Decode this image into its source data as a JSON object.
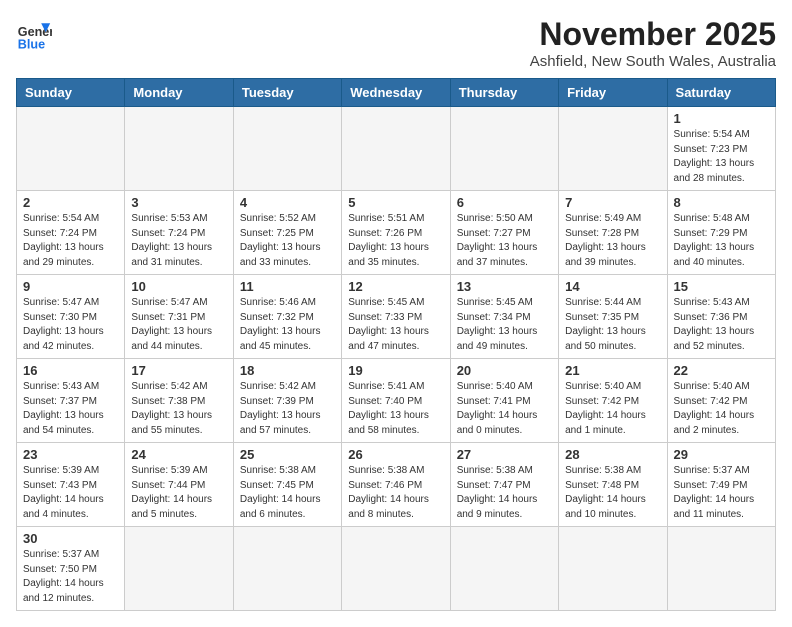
{
  "logo": {
    "line1": "General",
    "line2": "Blue"
  },
  "header": {
    "month": "November 2025",
    "location": "Ashfield, New South Wales, Australia"
  },
  "weekdays": [
    "Sunday",
    "Monday",
    "Tuesday",
    "Wednesday",
    "Thursday",
    "Friday",
    "Saturday"
  ],
  "weeks": [
    [
      {
        "day": "",
        "info": ""
      },
      {
        "day": "",
        "info": ""
      },
      {
        "day": "",
        "info": ""
      },
      {
        "day": "",
        "info": ""
      },
      {
        "day": "",
        "info": ""
      },
      {
        "day": "",
        "info": ""
      },
      {
        "day": "1",
        "info": "Sunrise: 5:54 AM\nSunset: 7:23 PM\nDaylight: 13 hours\nand 28 minutes."
      }
    ],
    [
      {
        "day": "2",
        "info": "Sunrise: 5:54 AM\nSunset: 7:24 PM\nDaylight: 13 hours\nand 29 minutes."
      },
      {
        "day": "3",
        "info": "Sunrise: 5:53 AM\nSunset: 7:24 PM\nDaylight: 13 hours\nand 31 minutes."
      },
      {
        "day": "4",
        "info": "Sunrise: 5:52 AM\nSunset: 7:25 PM\nDaylight: 13 hours\nand 33 minutes."
      },
      {
        "day": "5",
        "info": "Sunrise: 5:51 AM\nSunset: 7:26 PM\nDaylight: 13 hours\nand 35 minutes."
      },
      {
        "day": "6",
        "info": "Sunrise: 5:50 AM\nSunset: 7:27 PM\nDaylight: 13 hours\nand 37 minutes."
      },
      {
        "day": "7",
        "info": "Sunrise: 5:49 AM\nSunset: 7:28 PM\nDaylight: 13 hours\nand 39 minutes."
      },
      {
        "day": "8",
        "info": "Sunrise: 5:48 AM\nSunset: 7:29 PM\nDaylight: 13 hours\nand 40 minutes."
      }
    ],
    [
      {
        "day": "9",
        "info": "Sunrise: 5:47 AM\nSunset: 7:30 PM\nDaylight: 13 hours\nand 42 minutes."
      },
      {
        "day": "10",
        "info": "Sunrise: 5:47 AM\nSunset: 7:31 PM\nDaylight: 13 hours\nand 44 minutes."
      },
      {
        "day": "11",
        "info": "Sunrise: 5:46 AM\nSunset: 7:32 PM\nDaylight: 13 hours\nand 45 minutes."
      },
      {
        "day": "12",
        "info": "Sunrise: 5:45 AM\nSunset: 7:33 PM\nDaylight: 13 hours\nand 47 minutes."
      },
      {
        "day": "13",
        "info": "Sunrise: 5:45 AM\nSunset: 7:34 PM\nDaylight: 13 hours\nand 49 minutes."
      },
      {
        "day": "14",
        "info": "Sunrise: 5:44 AM\nSunset: 7:35 PM\nDaylight: 13 hours\nand 50 minutes."
      },
      {
        "day": "15",
        "info": "Sunrise: 5:43 AM\nSunset: 7:36 PM\nDaylight: 13 hours\nand 52 minutes."
      }
    ],
    [
      {
        "day": "16",
        "info": "Sunrise: 5:43 AM\nSunset: 7:37 PM\nDaylight: 13 hours\nand 54 minutes."
      },
      {
        "day": "17",
        "info": "Sunrise: 5:42 AM\nSunset: 7:38 PM\nDaylight: 13 hours\nand 55 minutes."
      },
      {
        "day": "18",
        "info": "Sunrise: 5:42 AM\nSunset: 7:39 PM\nDaylight: 13 hours\nand 57 minutes."
      },
      {
        "day": "19",
        "info": "Sunrise: 5:41 AM\nSunset: 7:40 PM\nDaylight: 13 hours\nand 58 minutes."
      },
      {
        "day": "20",
        "info": "Sunrise: 5:40 AM\nSunset: 7:41 PM\nDaylight: 14 hours\nand 0 minutes."
      },
      {
        "day": "21",
        "info": "Sunrise: 5:40 AM\nSunset: 7:42 PM\nDaylight: 14 hours\nand 1 minute."
      },
      {
        "day": "22",
        "info": "Sunrise: 5:40 AM\nSunset: 7:42 PM\nDaylight: 14 hours\nand 2 minutes."
      }
    ],
    [
      {
        "day": "23",
        "info": "Sunrise: 5:39 AM\nSunset: 7:43 PM\nDaylight: 14 hours\nand 4 minutes."
      },
      {
        "day": "24",
        "info": "Sunrise: 5:39 AM\nSunset: 7:44 PM\nDaylight: 14 hours\nand 5 minutes."
      },
      {
        "day": "25",
        "info": "Sunrise: 5:38 AM\nSunset: 7:45 PM\nDaylight: 14 hours\nand 6 minutes."
      },
      {
        "day": "26",
        "info": "Sunrise: 5:38 AM\nSunset: 7:46 PM\nDaylight: 14 hours\nand 8 minutes."
      },
      {
        "day": "27",
        "info": "Sunrise: 5:38 AM\nSunset: 7:47 PM\nDaylight: 14 hours\nand 9 minutes."
      },
      {
        "day": "28",
        "info": "Sunrise: 5:38 AM\nSunset: 7:48 PM\nDaylight: 14 hours\nand 10 minutes."
      },
      {
        "day": "29",
        "info": "Sunrise: 5:37 AM\nSunset: 7:49 PM\nDaylight: 14 hours\nand 11 minutes."
      }
    ],
    [
      {
        "day": "30",
        "info": "Sunrise: 5:37 AM\nSunset: 7:50 PM\nDaylight: 14 hours\nand 12 minutes."
      },
      {
        "day": "",
        "info": ""
      },
      {
        "day": "",
        "info": ""
      },
      {
        "day": "",
        "info": ""
      },
      {
        "day": "",
        "info": ""
      },
      {
        "day": "",
        "info": ""
      },
      {
        "day": "",
        "info": ""
      }
    ]
  ]
}
